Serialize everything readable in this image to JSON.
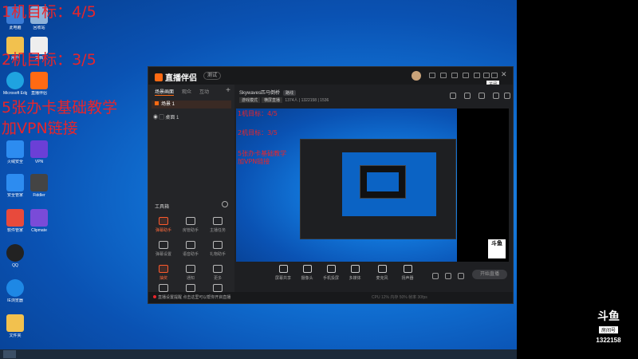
{
  "overlay": {
    "line1": "1机目标：4/5",
    "line2": "2机目标：3/5",
    "line3": "5张办卡基础教学",
    "line4": "加VPN链接"
  },
  "desktop_icons": [
    {
      "label": "此电脑",
      "color": "#3a7bd5"
    },
    {
      "label": "回收站",
      "color": "#8fb3d9"
    },
    {
      "label": "用户",
      "color": "#f2c14e"
    },
    {
      "label": "文档",
      "color": "#eeeeee"
    },
    {
      "label": "Microsoft Edge",
      "color": "#1fa3e0"
    },
    {
      "label": "直播伴侣",
      "color": "#ff6a13"
    },
    {
      "label": "腾讯文档",
      "color": "#3a7bd5"
    },
    {
      "label": "斗鱼",
      "color": "#ff6a13"
    },
    {
      "label": "火绒安全",
      "color": "#2d8cf0"
    },
    {
      "label": "VPN",
      "color": "#6b3fd6"
    },
    {
      "label": "安全管家",
      "color": "#2d8cf0"
    },
    {
      "label": "Fiddler",
      "color": "#444444"
    },
    {
      "label": "软件管家",
      "color": "#e84a3c"
    },
    {
      "label": "Clipmate",
      "color": "#7a4bd8"
    },
    {
      "label": "QQ",
      "color": "#222222"
    },
    {
      "label": "IE浏览器",
      "color": "#1e88e5"
    },
    {
      "label": "文件夹",
      "color": "#f2c14e"
    }
  ],
  "app": {
    "logo": "直播伴侣",
    "version": "测试",
    "tooltip": "关闭",
    "left_tabs": [
      "场景画面",
      "观众",
      "互动"
    ],
    "scene_name": "场景 1",
    "source_name": "桌面 1",
    "tools_title": "工具箱",
    "tools": [
      {
        "label": "弹幕助手",
        "hot": true
      },
      {
        "label": "房管助手",
        "hot": false
      },
      {
        "label": "主播任务",
        "hot": false
      },
      {
        "label": "弹幕设置",
        "hot": false
      },
      {
        "label": "语音助手",
        "hot": false
      },
      {
        "label": "礼物助手",
        "hot": false
      },
      {
        "label": "抽奖",
        "hot": true
      },
      {
        "label": "通知",
        "hot": false
      },
      {
        "label": "更多",
        "hot": false
      },
      {
        "label": "贴纸",
        "hot": false
      },
      {
        "label": "工具",
        "hot": false
      },
      {
        "label": "下载",
        "hot": false
      }
    ],
    "room_title": "Skywaves匹马倒桥",
    "room_badge": "路线",
    "sub_chips": [
      "游戏模式",
      "横屏直播"
    ],
    "sub_stats": "1374人 | 1322158 | 1536",
    "bottom_tools": [
      "屏幕共享",
      "摄像头",
      "手机投屏",
      "多媒体",
      "麦克风",
      "扬声器"
    ],
    "start_live": "开始直播",
    "notice": "直播设置提醒 点击这里可以帮你开启直播",
    "stats": "CPU 12%   内存 50%   帧率 30fps"
  },
  "preview": {
    "overlay1": "1机目标：4/5",
    "overlay2": "2机目标：3/5",
    "overlay3": "5张办卡基础教学",
    "overlay4": "加VPN链接",
    "logo": "斗鱼"
  },
  "douyu": {
    "logo": "斗鱼",
    "room_label": "房间号",
    "room_number": "1322158"
  }
}
